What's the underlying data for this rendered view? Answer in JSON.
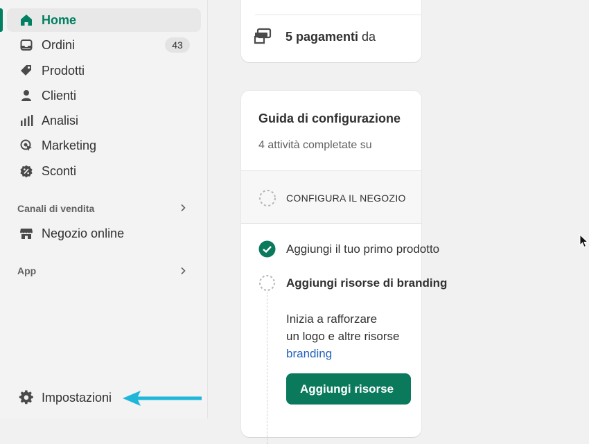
{
  "sidebar": {
    "items": [
      {
        "label": "Home",
        "icon": "home-icon",
        "active": true
      },
      {
        "label": "Ordini",
        "icon": "inbox-icon",
        "badge": "43"
      },
      {
        "label": "Prodotti",
        "icon": "tag-icon"
      },
      {
        "label": "Clienti",
        "icon": "person-icon"
      },
      {
        "label": "Analisi",
        "icon": "bar-chart-icon"
      },
      {
        "label": "Marketing",
        "icon": "target-icon"
      },
      {
        "label": "Sconti",
        "icon": "discount-icon"
      }
    ],
    "sales_channels_label": "Canali di vendita",
    "online_store_label": "Negozio online",
    "apps_label": "App",
    "settings_label": "Impostazioni"
  },
  "payments_card": {
    "bold": "5 pagamenti",
    "rest": "da"
  },
  "setup_guide": {
    "title": "Guida di configurazione",
    "subtitle": "4 attività completate su",
    "section_label": "CONFIGURA IL NEGOZIO",
    "step1": "Aggiungi il tuo primo prodotto",
    "step2": "Aggiungi risorse di branding",
    "desc_line1": "Inizia a rafforzare",
    "desc_line2": "un logo e altre risorse",
    "desc_link": "branding",
    "cta_label": "Aggiungi risorse"
  },
  "colors": {
    "accent": "#008060",
    "cta": "#0b7a5c",
    "link": "#2463bc",
    "annotation_arrow": "#1fb6da"
  }
}
